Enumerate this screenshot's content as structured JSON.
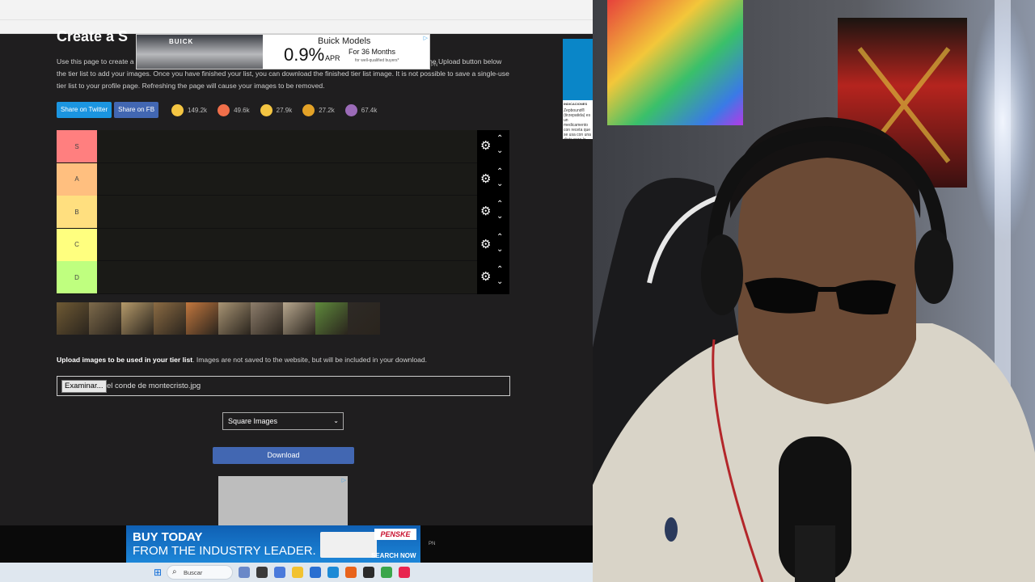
{
  "page": {
    "title": "Create a S",
    "description": "Use this page to create a tier list. You can drag and drop images into your list. Images are not saved to the website. Use the Upload button below the tier list to add your images. Once you have finished your list, you can download the finished tier list image. It is not possible to save a single-use tier list to your profile page. Refreshing the page will cause your images to be removed."
  },
  "share": {
    "twitter_label": "Share on Twitter",
    "fb_label": "Share on FB",
    "reactions": [
      {
        "icon": "grin-emoji-icon",
        "count": "149.2k",
        "color": "#f4c542"
      },
      {
        "icon": "heart-eyes-emoji-icon",
        "count": "49.6k",
        "color": "#f06f4a"
      },
      {
        "icon": "laughing-emoji-icon",
        "count": "27.9k",
        "color": "#f4c542"
      },
      {
        "icon": "raised-hands-emoji-icon",
        "count": "27.2k",
        "color": "#e3a227"
      },
      {
        "icon": "poop-emoji-icon",
        "count": "67.4k",
        "color": "#9b6bb8"
      }
    ]
  },
  "tiers": [
    {
      "label": "S",
      "color": "#ff7f7f"
    },
    {
      "label": "A",
      "color": "#ffbf7f"
    },
    {
      "label": "B",
      "color": "#ffdf7f"
    },
    {
      "label": "C",
      "color": "#ffff7f"
    },
    {
      "label": "D",
      "color": "#bfff7f"
    }
  ],
  "tier_controls": {
    "settings_icon": "gear-icon",
    "up_icon": "chevron-up-icon",
    "down_icon": "chevron-down-icon"
  },
  "image_bank": {
    "count": 10,
    "colors": [
      "#6f5a34",
      "#7d6a4b",
      "#b59a6a",
      "#8b6b43",
      "#c2773e",
      "#a89474",
      "#8d7d6b",
      "#b7a78e",
      "#5f8a3c",
      "#2e2a26"
    ]
  },
  "upload": {
    "label_bold": "Upload images to be used in your tier list",
    "label_rest": ". Images are not saved to the website, but will be included in your download.",
    "file_button": "Examinar...",
    "file_name": "el conde de montecristo.jpg"
  },
  "image_style": {
    "selected": "Square Images"
  },
  "download_label": "Download",
  "ads": {
    "top": {
      "brand": "BUICK",
      "headline": "Buick Models",
      "rate": "0.9%",
      "apr": "APR",
      "term": "For 36 Months",
      "fine": "for well-qualified buyers*",
      "tag": "PN"
    },
    "side": {
      "label": "INDICACIONES",
      "text": "Zepbound® (tirzepatida) es un medicamento con receta que se usa con una dieta para la obesidad que tiene relación"
    },
    "bottom": {
      "line1": "BUY TODAY",
      "line2": "FROM THE INDUSTRY LEADER.",
      "logo": "PENSKE",
      "cta": "SEARCH NOW",
      "tag": "PN"
    }
  },
  "taskbar": {
    "search_placeholder": "Buscar",
    "apps": [
      {
        "icon": "photo-app-icon",
        "color": "#6a88c8"
      },
      {
        "icon": "task-view-icon",
        "color": "#3a3a3a"
      },
      {
        "icon": "copilot-icon",
        "color": "#4a7adb"
      },
      {
        "icon": "file-explorer-icon",
        "color": "#f2c230"
      },
      {
        "icon": "store-icon",
        "color": "#2a6fd1"
      },
      {
        "icon": "edge-icon",
        "color": "#1c8ad6"
      },
      {
        "icon": "firefox-icon",
        "color": "#e8631b"
      },
      {
        "icon": "obs-icon",
        "color": "#2b2b2b"
      },
      {
        "icon": "xbox-icon",
        "color": "#3aa64a"
      },
      {
        "icon": "tiktok-icon",
        "color": "#e8244f"
      }
    ]
  }
}
